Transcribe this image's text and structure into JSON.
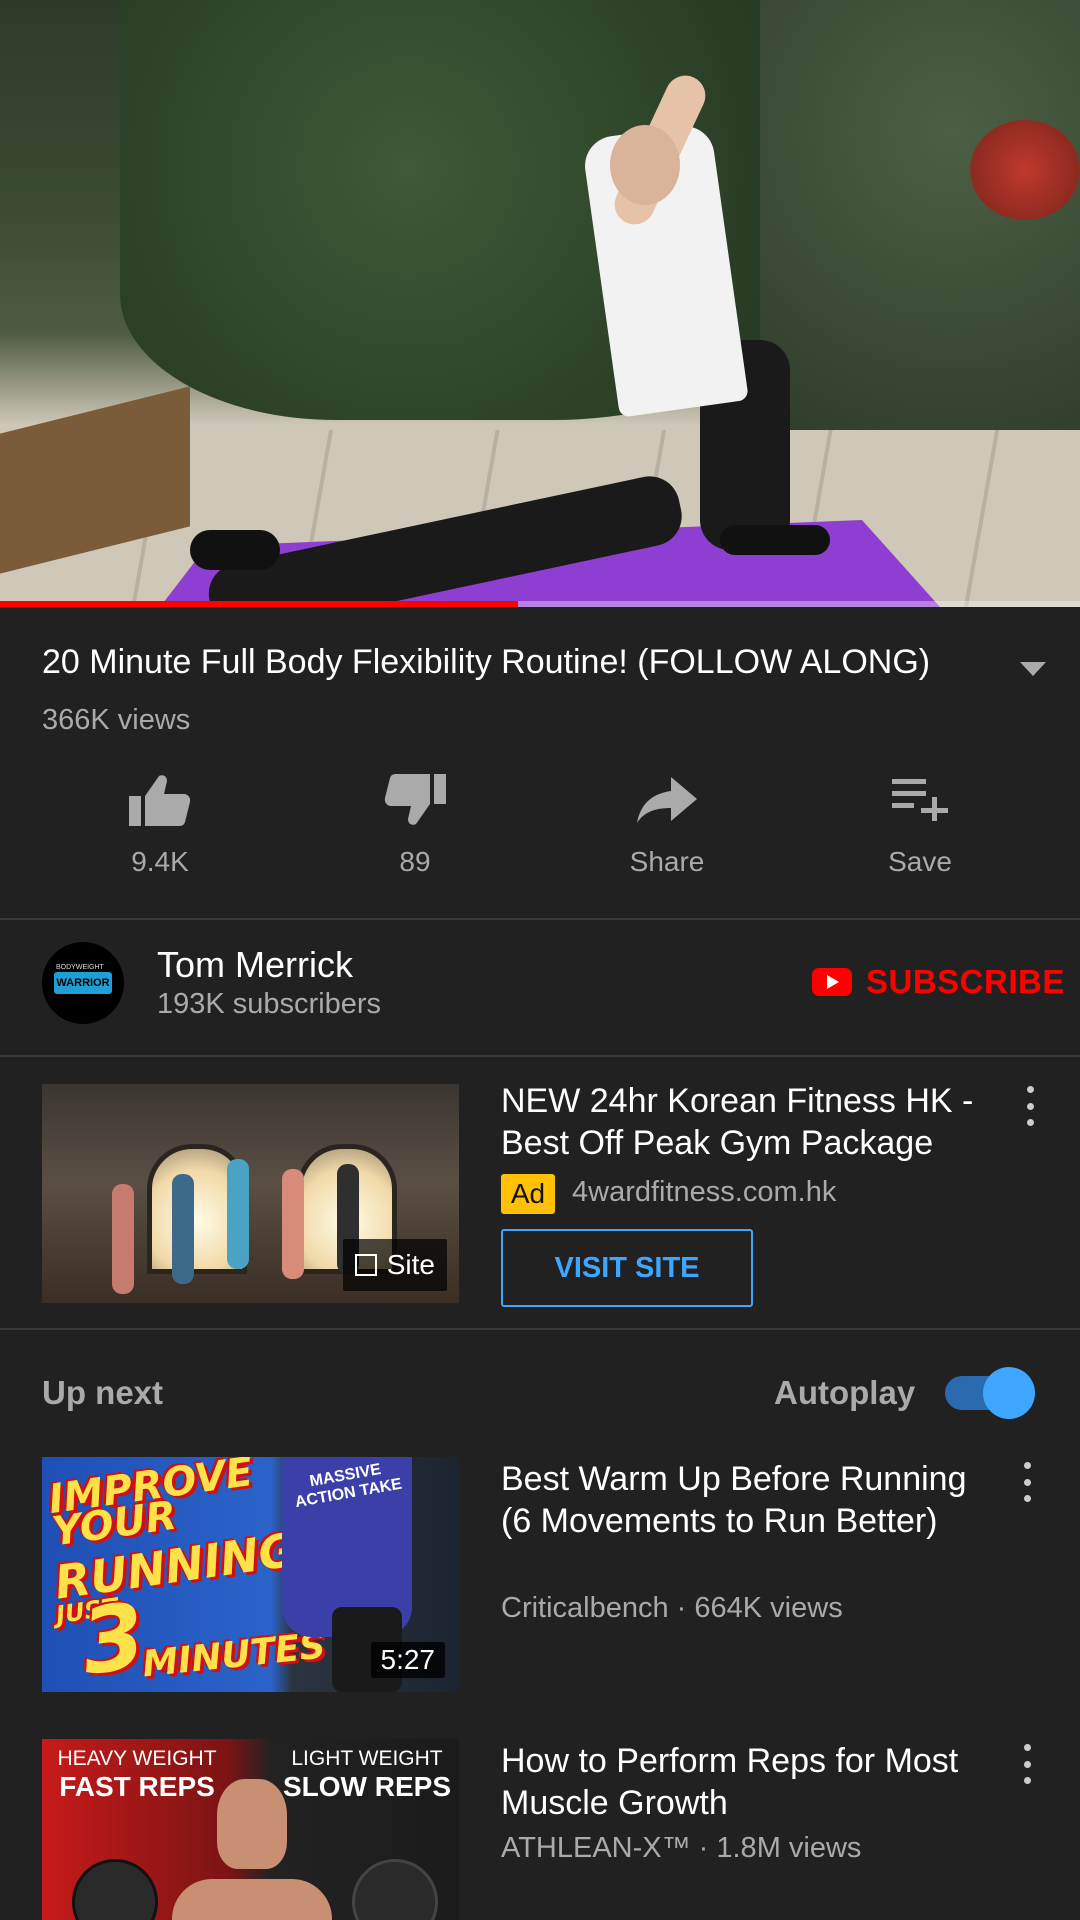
{
  "video": {
    "progress_fraction": 0.48,
    "title": "20 Minute Full Body Flexibility Routine! (FOLLOW ALONG)",
    "views": "366K views"
  },
  "actions": [
    {
      "icon": "thumbs-up-icon",
      "label": "9.4K"
    },
    {
      "icon": "thumbs-down-icon",
      "label": "89"
    },
    {
      "icon": "share-icon",
      "label": "Share"
    },
    {
      "icon": "playlist-add-icon",
      "label": "Save"
    }
  ],
  "channel": {
    "name": "Tom Merrick",
    "subscribers": "193K subscribers",
    "logo_text": "WARRIOR",
    "logo_top": "BODYWEIGHT",
    "subscribe_label": "SUBSCRIBE"
  },
  "ad": {
    "title": "NEW 24hr Korean Fitness HK - Best Off Peak Gym Package",
    "badge": "Ad",
    "url": "4wardfitness.com.hk",
    "cta": "VISIT SITE",
    "site_badge": "Site"
  },
  "upnext": {
    "label": "Up next",
    "autoplay_label": "Autoplay",
    "autoplay_on": true
  },
  "videos": [
    {
      "title": "Best Warm Up Before Running (6 Movements to Run Better)",
      "meta": "Criticalbench · 664K views",
      "duration": "5:27",
      "thumb_lines": [
        "IMPROVE",
        "YOUR",
        "RUNNING",
        "JUST",
        "3",
        "MINUTES"
      ],
      "shirt_text": "MASSIVE ACTION TAKE"
    },
    {
      "title": "How to Perform Reps for Most Muscle Growth",
      "meta": "ATHLEAN-X™ · 1.8M views",
      "thumb_left_top": "HEAVY WEIGHT",
      "thumb_left_bottom": "FAST REPS",
      "thumb_right_top": "LIGHT WEIGHT",
      "thumb_right_bottom": "SLOW REPS"
    }
  ],
  "colors": {
    "background": "#212121",
    "accent_blue": "#3ea6ff",
    "youtube_red": "#ff0000",
    "ad_badge": "#ffc107"
  }
}
